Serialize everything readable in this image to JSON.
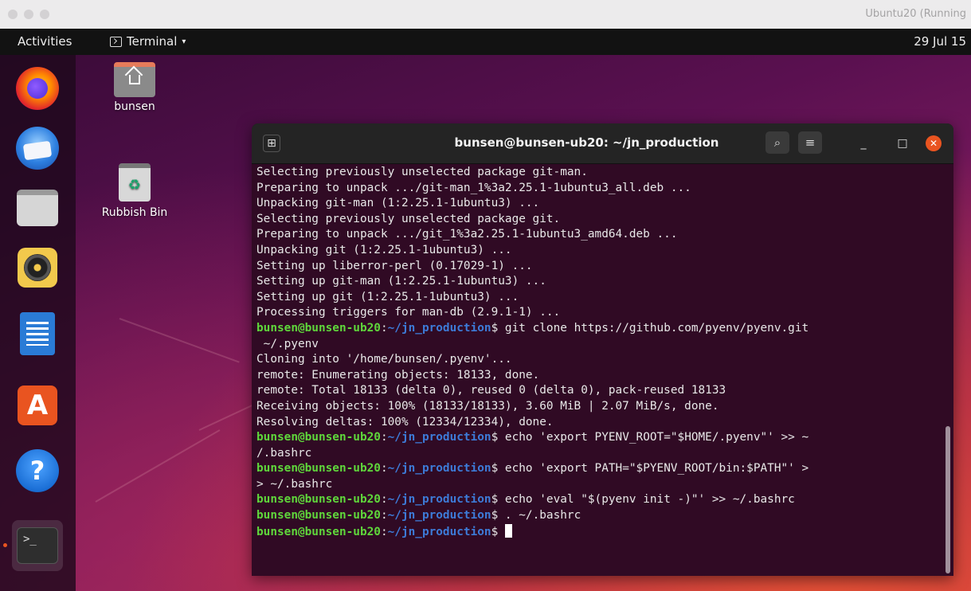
{
  "vm_window": {
    "title": "Ubuntu20 (Running"
  },
  "topbar": {
    "activities": "Activities",
    "app_menu": "Terminal",
    "app_menu_caret": "▾",
    "clock": "29 Jul 15"
  },
  "dock": {
    "items": [
      {
        "name": "firefox",
        "icon": "firefox-icon"
      },
      {
        "name": "thunderbird",
        "icon": "thunderbird-icon"
      },
      {
        "name": "files",
        "icon": "files-icon"
      },
      {
        "name": "rhythmbox",
        "icon": "rhythmbox-icon"
      },
      {
        "name": "libreoffice-writer",
        "icon": "writer-icon"
      },
      {
        "name": "ubuntu-software",
        "icon": "software-icon",
        "glyph": "A"
      },
      {
        "name": "help",
        "icon": "help-icon",
        "glyph": "?"
      },
      {
        "name": "terminal",
        "icon": "terminal-icon",
        "glyph": ">_",
        "active": true
      }
    ]
  },
  "desktop": {
    "icons": [
      {
        "label": "bunsen",
        "icon": "home-folder-icon"
      },
      {
        "label": "Rubbish Bin",
        "icon": "rubbish-bin-icon",
        "glyph": "♻"
      }
    ]
  },
  "terminal": {
    "title": "bunsen@bunsen-ub20: ~/jn_production",
    "newtab_glyph": "⊞",
    "search_glyph": "⌕",
    "menu_glyph": "≡",
    "minimize_glyph": "_",
    "maximize_glyph": "□",
    "close_glyph": "✕",
    "prompt_user": "bunsen@bunsen-ub20",
    "prompt_sep": ":",
    "prompt_path": "~/jn_production",
    "prompt_end": "$",
    "lines": [
      {
        "text": "Selecting previously unselected package git-man."
      },
      {
        "text": "Preparing to unpack .../git-man_1%3a2.25.1-1ubuntu3_all.deb ..."
      },
      {
        "text": "Unpacking git-man (1:2.25.1-1ubuntu3) ..."
      },
      {
        "text": "Selecting previously unselected package git."
      },
      {
        "text": "Preparing to unpack .../git_1%3a2.25.1-1ubuntu3_amd64.deb ..."
      },
      {
        "text": "Unpacking git (1:2.25.1-1ubuntu3) ..."
      },
      {
        "text": "Setting up liberror-perl (0.17029-1) ..."
      },
      {
        "text": "Setting up git-man (1:2.25.1-1ubuntu3) ..."
      },
      {
        "text": "Setting up git (1:2.25.1-1ubuntu3) ..."
      },
      {
        "text": "Processing triggers for man-db (2.9.1-1) ..."
      },
      {
        "prompt": true,
        "text": " git clone https://github.com/pyenv/pyenv.git"
      },
      {
        "text": " ~/.pyenv"
      },
      {
        "text": "Cloning into '/home/bunsen/.pyenv'..."
      },
      {
        "text": "remote: Enumerating objects: 18133, done."
      },
      {
        "text": "remote: Total 18133 (delta 0), reused 0 (delta 0), pack-reused 18133"
      },
      {
        "text": "Receiving objects: 100% (18133/18133), 3.60 MiB | 2.07 MiB/s, done."
      },
      {
        "text": "Resolving deltas: 100% (12334/12334), done."
      },
      {
        "prompt": true,
        "text": " echo 'export PYENV_ROOT=\"$HOME/.pyenv\"' >> ~"
      },
      {
        "text": "/.bashrc"
      },
      {
        "prompt": true,
        "text": " echo 'export PATH=\"$PYENV_ROOT/bin:$PATH\"' >"
      },
      {
        "text": "> ~/.bashrc"
      },
      {
        "prompt": true,
        "text": " echo 'eval \"$(pyenv init -)\"' >> ~/.bashrc"
      },
      {
        "prompt": true,
        "text": " . ~/.bashrc"
      },
      {
        "prompt": true,
        "text": " ",
        "cursor": true
      }
    ]
  }
}
